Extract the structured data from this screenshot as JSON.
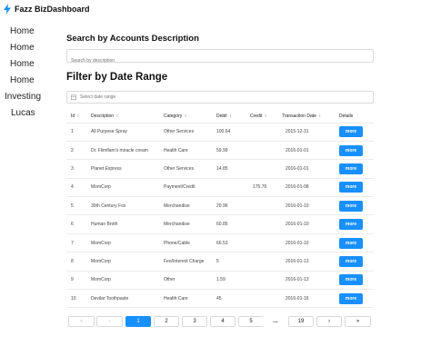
{
  "brand": {
    "name": "Fazz BizDashboard",
    "icon": "bolt-icon",
    "color": "#1890ff"
  },
  "sidebar": {
    "items": [
      {
        "label": "Home"
      },
      {
        "label": "Home"
      },
      {
        "label": "Home"
      },
      {
        "label": "Home"
      },
      {
        "label": "Investing"
      },
      {
        "label": "Lucas"
      }
    ]
  },
  "search": {
    "title": "Search by Accounts Description",
    "placeholder": "Search by description"
  },
  "date_filter": {
    "title": "Filter by Date Range",
    "placeholder": "Select date range",
    "icon": "calendar-icon"
  },
  "table": {
    "columns": [
      "Id",
      "Description",
      "Category",
      "Debit",
      "Credit",
      "Transaction Date",
      "Details"
    ],
    "rows": [
      {
        "id": "1",
        "description": "All Purpose Spray",
        "category": "Other Services",
        "debit": "100.64",
        "credit": "",
        "date": "2015-12-31",
        "action": "more"
      },
      {
        "id": "2",
        "description": "Dr. Flimflam's miracle cream",
        "category": "Health Care",
        "debit": "59.99",
        "credit": "",
        "date": "2016-01-01",
        "action": "more"
      },
      {
        "id": "3",
        "description": "Planet Express",
        "category": "Other Services",
        "debit": "14.85",
        "credit": "",
        "date": "2016-01-01",
        "action": "more"
      },
      {
        "id": "4",
        "description": "MomCorp",
        "category": "Payment/Credit",
        "debit": "",
        "credit": "175.76",
        "date": "2016-01-08",
        "action": "more"
      },
      {
        "id": "5",
        "description": "30th Century Fox",
        "category": "Merchandise",
        "debit": "20.96",
        "credit": "",
        "date": "2016-01-10",
        "action": "more"
      },
      {
        "id": "6",
        "description": "Human Broth",
        "category": "Merchandise",
        "debit": "60.85",
        "credit": "",
        "date": "2016-01-10",
        "action": "more"
      },
      {
        "id": "7",
        "description": "MomCorp",
        "category": "Phone/Cable",
        "debit": "66.53",
        "credit": "",
        "date": "2016-01-10",
        "action": "more"
      },
      {
        "id": "8",
        "description": "MomCorp",
        "category": "Fee/Interest Charge",
        "debit": "5",
        "credit": "",
        "date": "2016-01-13",
        "action": "more"
      },
      {
        "id": "9",
        "description": "MomCorp",
        "category": "Other",
        "debit": "1.59",
        "credit": "",
        "date": "2016-01-13",
        "action": "more"
      },
      {
        "id": "10",
        "description": "Devilar Toothpaste",
        "category": "Health Care",
        "debit": "45",
        "credit": "",
        "date": "2016-01-16",
        "action": "more"
      }
    ]
  },
  "pagination": {
    "first": "«",
    "prev": "‹",
    "pages": [
      "1",
      "2",
      "3",
      "4",
      "5"
    ],
    "ellipsis": "…",
    "last_page": "19",
    "next": "›",
    "last": "»",
    "current": "1"
  }
}
